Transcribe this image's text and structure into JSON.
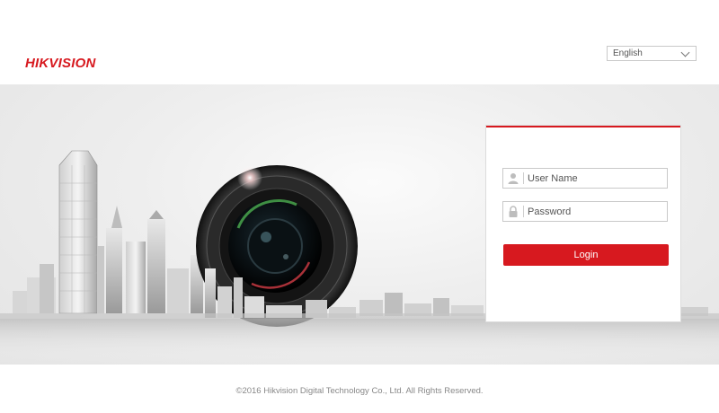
{
  "header": {
    "logo_text": "HIKVISION",
    "language": {
      "selected": "English"
    }
  },
  "login": {
    "username_placeholder": "User Name",
    "password_placeholder": "Password",
    "login_label": "Login"
  },
  "footer": {
    "copyright": "©2016 Hikvision Digital Technology Co., Ltd. All Rights Reserved."
  },
  "colors": {
    "brand_red": "#d7191f",
    "background": "#ffffff",
    "hero_gray": "#e8e8e8"
  },
  "icons": {
    "language_dropdown": "chevron-down-icon",
    "username_field": "user-icon",
    "password_field": "lock-icon"
  }
}
